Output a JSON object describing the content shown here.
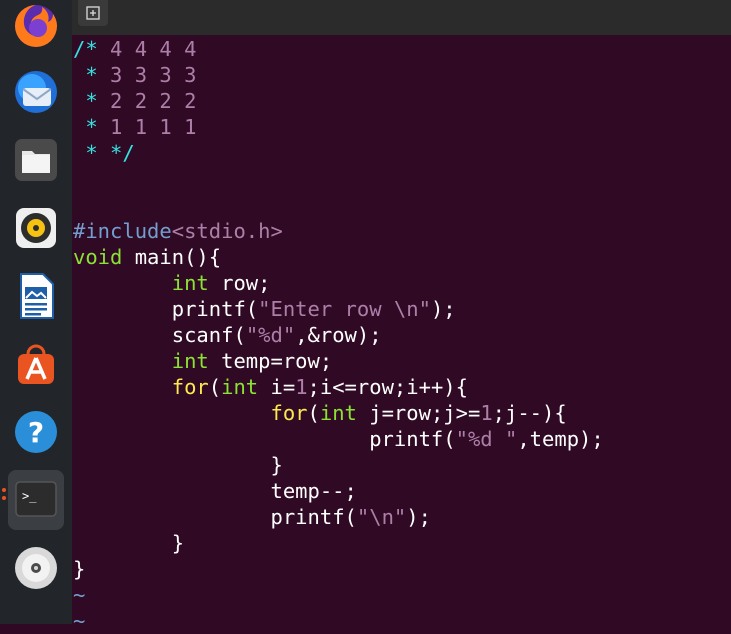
{
  "dock": {
    "apps": [
      {
        "name": "firefox",
        "label": "Firefox"
      },
      {
        "name": "thunderbird",
        "label": "Thunderbird"
      },
      {
        "name": "files",
        "label": "Files"
      },
      {
        "name": "rhythmbox",
        "label": "Rhythmbox"
      },
      {
        "name": "libreoffice-writer",
        "label": "LibreOffice Writer"
      },
      {
        "name": "software",
        "label": "Ubuntu Software"
      },
      {
        "name": "help",
        "label": "Help"
      },
      {
        "name": "terminal",
        "label": "Terminal"
      },
      {
        "name": "dvd",
        "label": "DVD"
      }
    ]
  },
  "editor": {
    "comment": {
      "l1_open": "/*",
      "l1_nums": " 4 4 4 4",
      "l2_star": " *",
      "l2_nums": " 3 3 3 3",
      "l3_star": " *",
      "l3_nums": " 2 2 2 2",
      "l4_star": " *",
      "l4_nums": " 1 1 1 1",
      "l5": " * */"
    },
    "include": {
      "directive": "#include",
      "header": "<stdio.h>"
    },
    "main": {
      "type": "void",
      "rest": " main(){"
    },
    "decl_row": {
      "indent": "        ",
      "type": "int",
      "rest": " row;"
    },
    "printf1": {
      "indent": "        ",
      "pre": "printf(",
      "str": "\"Enter row \\n\"",
      "post": ");"
    },
    "scanf": {
      "indent": "        ",
      "pre": "scanf(",
      "str": "\"%d\"",
      "post": ",&row);"
    },
    "decl_temp": {
      "indent": "        ",
      "type": "int",
      "rest": " temp=row;"
    },
    "for1": {
      "indent": "        ",
      "kw": "for",
      "p1": "(",
      "type": "int",
      "p2": " i=",
      "n1": "1",
      "p3": ";i<=row;i++){"
    },
    "for2": {
      "indent": "                ",
      "kw": "for",
      "p1": "(",
      "type": "int",
      "p2": " j=row;j>=",
      "n1": "1",
      "p3": ";j--){"
    },
    "printf2": {
      "indent": "                        ",
      "pre": "printf(",
      "str": "\"%d \"",
      "post": ",temp);"
    },
    "close_inner": "                }",
    "temp_dec": "                temp--;",
    "printf3": {
      "indent": "                ",
      "pre": "printf(",
      "str": "\"\\n\"",
      "post": ");"
    },
    "close_outer": "        }",
    "close_main": "}",
    "tilde1": "~",
    "tilde2": "~"
  }
}
